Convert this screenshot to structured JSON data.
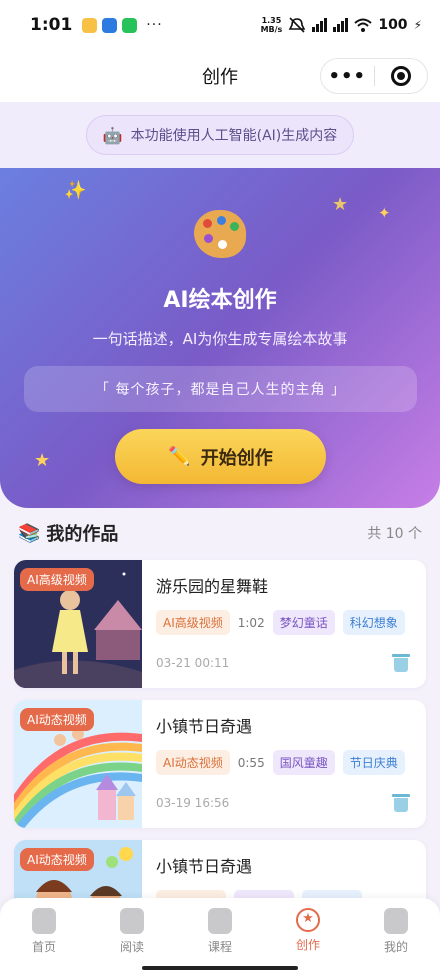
{
  "status_bar": {
    "time": "1:01",
    "speed_top": "1.35",
    "speed_bottom": "MB/s",
    "battery": "100"
  },
  "nav": {
    "title": "创作"
  },
  "notice": {
    "icon": "robot-icon",
    "text": "本功能使用人工智能(AI)生成内容"
  },
  "hero": {
    "title": "AI绘本创作",
    "subtitle": "一句话描述，AI为你生成专属绘本故事",
    "quote": "「 每个孩子，都是自己人生的主角 」",
    "start_button": "开始创作",
    "start_icon": "pencil-icon"
  },
  "works": {
    "title": "我的作品",
    "count": "共 10 个",
    "items": [
      {
        "badge": "AI高级视频",
        "title": "游乐园的星舞鞋",
        "type": "AI高级视频",
        "duration": "1:02",
        "tag1": "梦幻童话",
        "tag2": "科幻想象",
        "date": "03-21 00:11"
      },
      {
        "badge": "AI动态视频",
        "title": "小镇节日奇遇",
        "type": "AI动态视频",
        "duration": "0:55",
        "tag1": "国风童趣",
        "tag2": "节日庆典",
        "date": "03-19 16:56"
      },
      {
        "badge": "AI动态视频",
        "title": "小镇节日奇遇",
        "type": "",
        "duration": "",
        "tag1": "",
        "tag2": "",
        "date": ""
      }
    ]
  },
  "tabbar": {
    "items": [
      {
        "label": "首页",
        "icon": "home-icon"
      },
      {
        "label": "阅读",
        "icon": "book-icon"
      },
      {
        "label": "课程",
        "icon": "course-icon"
      },
      {
        "label": "创作",
        "icon": "create-icon"
      },
      {
        "label": "我的",
        "icon": "profile-icon"
      }
    ],
    "active": "创作"
  },
  "colors": {
    "accent": "#e46a4a",
    "hero_start": "#6b7fe0",
    "hero_end": "#c77fe6",
    "button": "#f3b833"
  }
}
